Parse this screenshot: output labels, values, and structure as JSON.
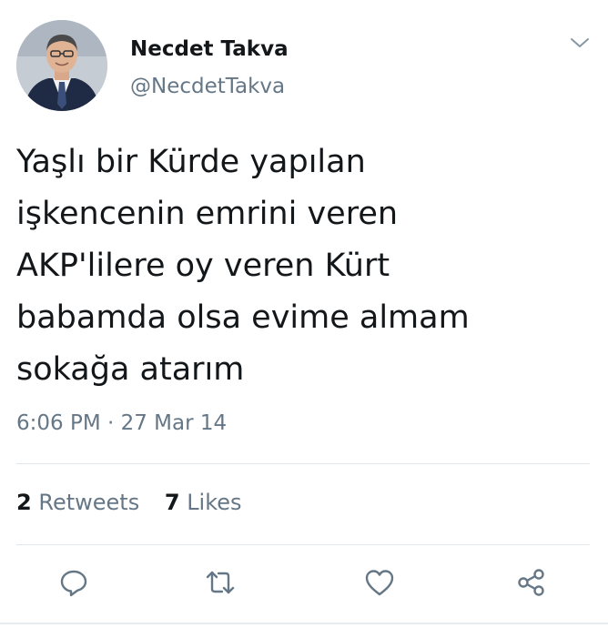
{
  "user": {
    "display_name": "Necdet Takva",
    "handle": "@NecdetTakva",
    "avatar_icon": "profile-photo"
  },
  "tweet": {
    "text": "Yaşlı bir Kürde yapılan\nişkencenin emrini veren\nAKP'lilere oy veren Kürt\nbabamda olsa evime almam\nsokağa atarım",
    "timestamp": "6:06 PM · 27 Mar 14"
  },
  "stats": {
    "retweets_count": "2",
    "retweets_label": "Retweets",
    "likes_count": "7",
    "likes_label": "Likes"
  },
  "actions": {
    "reply_icon": "reply-icon",
    "retweet_icon": "retweet-icon",
    "like_icon": "heart-icon",
    "share_icon": "share-icon"
  },
  "colors": {
    "text_primary": "#14171a",
    "text_secondary": "#657786",
    "icon_gray": "#657786",
    "divider": "#e1e8ed"
  }
}
